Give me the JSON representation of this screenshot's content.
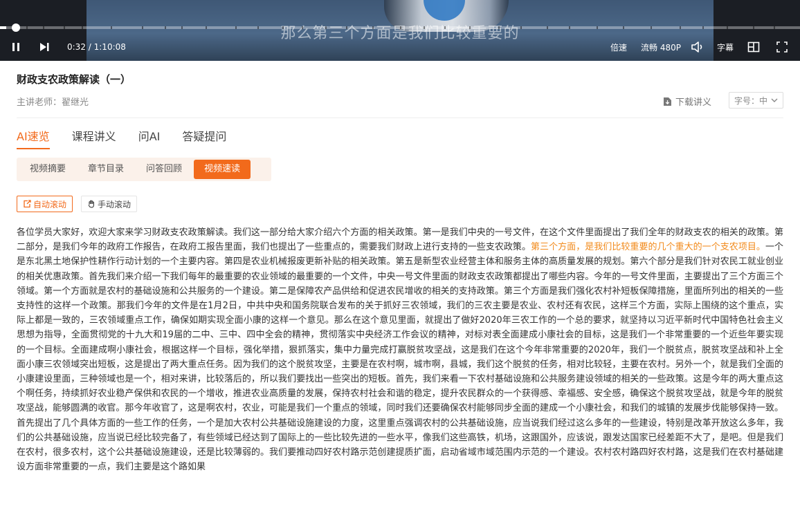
{
  "player": {
    "subtitle": "那么第三个方面是我们比较重要的",
    "current_time": "0:32",
    "total_time": "1:10:08",
    "progress_percent": 0.8,
    "speed_label": "倍速",
    "quality_label": "流畅 480P",
    "caption_label": "字幕",
    "icons": [
      "pause-icon",
      "next-icon",
      "volume-icon",
      "layout-icon",
      "fullscreen-icon"
    ]
  },
  "course": {
    "title": "财政支农政策解读（一）",
    "teacher": "主讲老师：翟继光",
    "download_label": "下载讲义",
    "font_size_label": "字号：中"
  },
  "tabs": [
    {
      "label": "AI速览",
      "active": true
    },
    {
      "label": "课程讲义",
      "active": false
    },
    {
      "label": "问AI",
      "active": false
    },
    {
      "label": "答疑提问",
      "active": false
    }
  ],
  "subtabs": [
    {
      "label": "视频摘要",
      "active": false
    },
    {
      "label": "章节目录",
      "active": false
    },
    {
      "label": "问答回顾",
      "active": false
    },
    {
      "label": "视频速读",
      "active": true
    }
  ],
  "scroll": {
    "auto_label": "自动滚动",
    "manual_label": "手动滚动"
  },
  "transcript": {
    "before": "各位学员大家好，欢迎大家来学习财政支农政策解读。我们这一部分给大家介绍六个方面的相关政策。第一是我们中央的一号文件，在这个文件里面提出了我们全年的财政支农的相关的政策。第二部分，是我们今年的政府工作报告，在政府工报告里面，我们也提出了一些重点的，需要我们财政上进行支持的一些支农政策。",
    "highlight": "第三个方面，是我们比较重要的几个重大的一个支农项目。",
    "after": "一个是东北黑土地保护性耕作行动计划的一个主要内容。第四是农业机械报废更新补贴的相关政策。第五是新型农业经营主体和服务主体的高质量发展的规划。第六个部分是我们针对农民工就业创业的相关优惠政策。首先我们来介绍一下我们每年的最重要的农业领域的最重要的一个文件，中央一号文件里面的财政支农政策都提出了哪些内容。今年的一号文件里面，主要提出了三个方面三个领域。第一个方面就是农村的基础设施和公共服务的一个建设。第二是保障农产品供给和促进农民增收的相关的支持政策。第三个方面是我们强化农村补短板保障措施，里面所列出的相关的一些支持性的这样一个政策。那我们今年的文件是在1月2日，中共中央和国务院联合发布的关于抓好三农领域，我们的三农主要是农业、农村还有农民，这样三个方面，实际上围绕的这个重点，实际上都是一致的，三农领域重点工作，确保如期实现全面小康的这样一个意见。那么在这个意见里面，就提出了做好2020年三农工作的一个总的要求，就坚持以习近平新时代中国特色社会主义思想为指导，全面贯彻党的十九大和19届的二中、三中、四中全会的精神，贯彻落实中央经济工作会议的精神，对标对表全面建成小康社会的目标，这是我们一个非常重要的一个近些年要实现的一个目标。全面建成啊小康社会，根据这样一个目标，强化举措，狠抓落实，集中力量完成打赢脱贫攻坚战，这是我们在这个今年非常重要的2020年，我们一个脱贫点，脱贫攻坚战和补上全面小康三农领域突出短板，这是提出了两大重点任务。因为我们的这个脱贫攻坚，主要是在农村啊，城市啊，县城，我们这个脱贫的任务，相对比较轻，主要在农村。另外一个，就是我们全面的小康建设里面，三种领域也是一个，相对来讲，比较落后的，所以我们要找出一些突出的短板。首先，我们来看一下农村基础设施和公共服务建设领域的相关的一些政策。这是今年的两大重点这个啊任务，持续抓好农业稳产保供和农民的一个增收，推进农业高质量的发展，保持农村社会和谐的稳定，提升农民群众的一个获得感、幸福感、安全感，确保这个脱贫攻坚战，就是今年的脱贫攻坚战，能够圆满的收官。那今年收官了，这是啊农村，农业，可能是我们一个重点的领域，同时我们还要确保农村能够同步全面的建成一个小康社会，和我们的城镇的发展步伐能够保持一致。首先提出了几个具体方面的一些工作的任务，一个是加大农村公共基础设施建设的力度，这里重点强调农村的公共基础设施，应当说我们经过这么多年的一些建设，特别是改革开放这么多年，我们的公共基础设施，应当说已经比较完备了，有些领域已经达到了国际上的一些比较先进的一些水平，像我们这些高铁，机场，这跟国外，应该说，跟发达国家已经差距不大了，是吧。但是我们在农村，很多农村，这个公共基础设施建设，还是比较薄弱的。我们要推动四好农村路示范创建提质扩面，启动省域市域范围内示范的一个建设。农村农村路四好农村路，这是我们在农村基础建设方面非常重要的一点，我们主要是这个路如果"
  },
  "colors": {
    "accent": "#f26a1b",
    "highlight_text": "#f28a1b",
    "subtab_bg": "#fbf1ea"
  }
}
